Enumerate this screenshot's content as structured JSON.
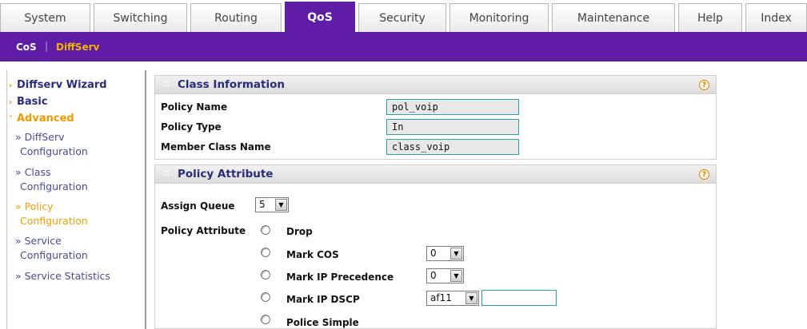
{
  "tabs": [
    {
      "label": "System",
      "active": false
    },
    {
      "label": "Switching",
      "active": false
    },
    {
      "label": "Routing",
      "active": false
    },
    {
      "label": "QoS",
      "active": true
    },
    {
      "label": "Security",
      "active": false
    },
    {
      "label": "Monitoring",
      "active": false
    },
    {
      "label": "Maintenance",
      "active": false
    },
    {
      "label": "Help",
      "active": false
    },
    {
      "label": "Index",
      "active": false
    }
  ],
  "subnav": {
    "items": [
      "CoS",
      "DiffServ"
    ],
    "separator": "|",
    "active": "DiffServ"
  },
  "sidebar": {
    "items": [
      {
        "label": "Diffserv Wizard"
      },
      {
        "label": "Basic"
      },
      {
        "label": "Advanced"
      }
    ],
    "sub_items": [
      {
        "line1": "» DiffServ",
        "line2": "Configuration"
      },
      {
        "line1": "» Class",
        "line2": "Configuration"
      },
      {
        "line1": "» Policy",
        "line2": "Configuration"
      },
      {
        "line1": "» Service",
        "line2": "Configuration"
      },
      {
        "line1": "» Service Statistics"
      }
    ],
    "arrow_collapsed": "›",
    "arrow_expanded": "˅"
  },
  "class_info": {
    "title": "Class Information",
    "dots": "::",
    "help": "?",
    "rows": [
      {
        "label": "Policy Name",
        "value": "pol_voip"
      },
      {
        "label": "Policy Type",
        "value": "In"
      },
      {
        "label": "Member Class Name",
        "value": "class_voip"
      }
    ]
  },
  "policy_attr": {
    "title": "Policy Attribute",
    "dots": "::",
    "help": "?",
    "assign_queue_label": "Assign Queue",
    "assign_queue_value": "5",
    "policy_attribute_label": "Policy Attribute",
    "options": [
      {
        "label": "Drop"
      },
      {
        "label": "Mark COS",
        "select": "0"
      },
      {
        "label": "Mark IP Precedence",
        "select": "0"
      },
      {
        "label": "Mark IP DSCP",
        "select": "af11",
        "text": ""
      },
      {
        "label": "Police Simple"
      }
    ],
    "dropdown_glyph": "▼"
  },
  "colors": {
    "accent": "#5f1ca5",
    "highlight": "#f5b400",
    "field_border": "#2aa5a5"
  }
}
